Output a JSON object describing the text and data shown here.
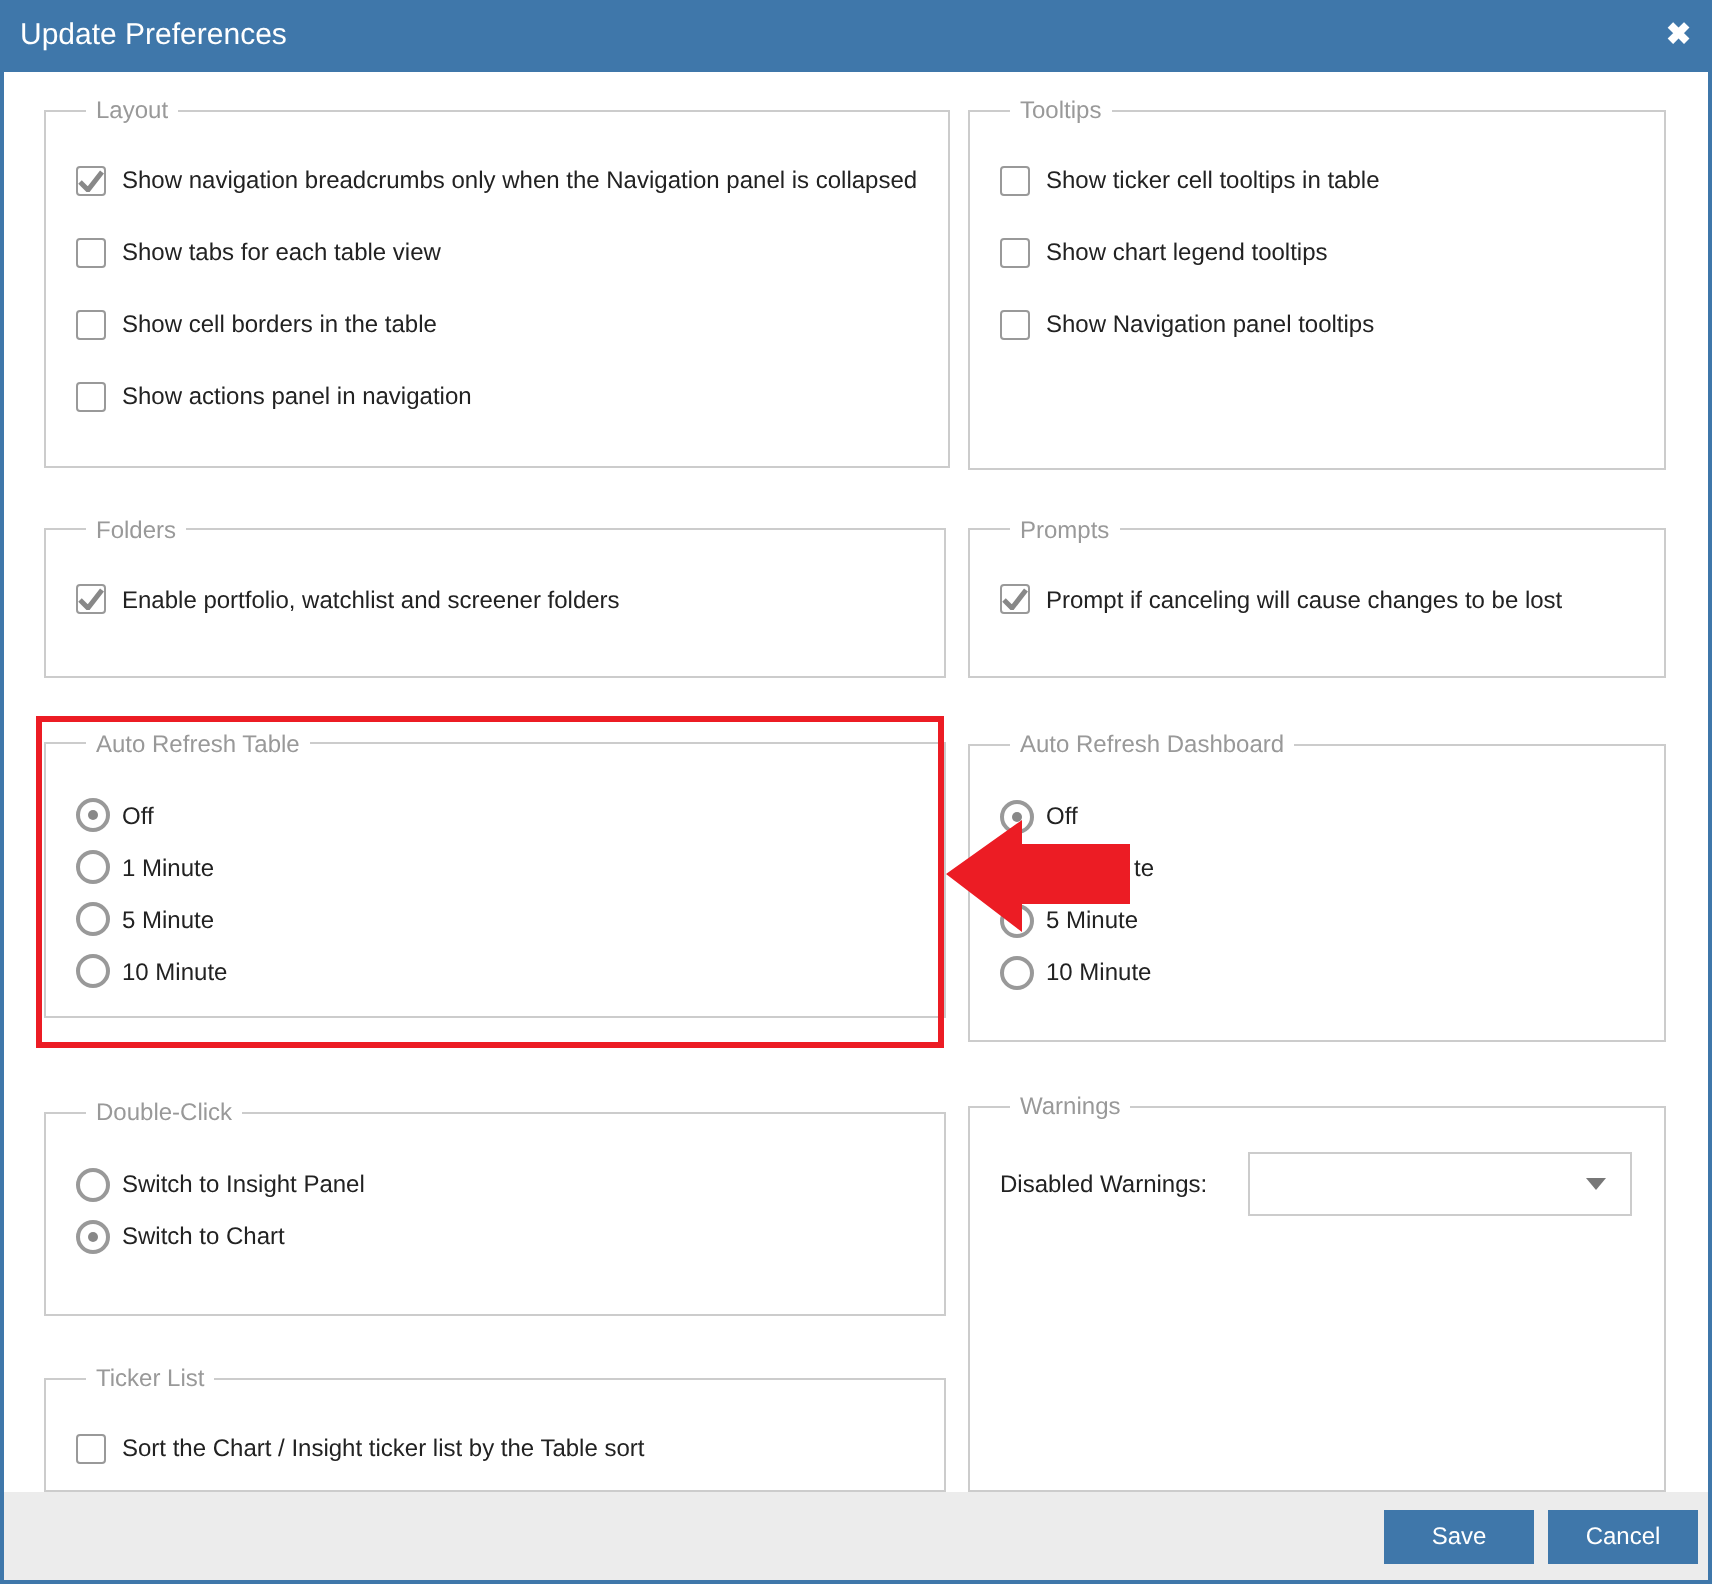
{
  "window": {
    "title": "Update Preferences",
    "close": "✖"
  },
  "left": [
    {
      "kind": "checks",
      "legend": "Layout",
      "items": [
        {
          "label": "Show navigation breadcrumbs only when the Navigation panel is collapsed",
          "checked": true
        },
        {
          "label": "Show tabs for each table view",
          "checked": false
        },
        {
          "label": "Show cell borders in the table",
          "checked": false
        },
        {
          "label": "Show actions panel in navigation",
          "checked": false
        }
      ]
    },
    {
      "kind": "checks",
      "legend": "Folders",
      "items": [
        {
          "label": "Enable portfolio, watchlist and screener folders",
          "checked": true
        }
      ]
    },
    {
      "kind": "radios",
      "legend": "Auto Refresh Table",
      "items": [
        {
          "label": "Off",
          "selected": true
        },
        {
          "label": "1 Minute",
          "selected": false
        },
        {
          "label": "5 Minute",
          "selected": false
        },
        {
          "label": "10 Minute",
          "selected": false
        }
      ]
    },
    {
      "kind": "radios",
      "legend": "Double-Click",
      "items": [
        {
          "label": "Switch to Insight Panel",
          "selected": false
        },
        {
          "label": "Switch to Chart",
          "selected": true
        }
      ]
    },
    {
      "kind": "checks",
      "legend": "Ticker List",
      "items": [
        {
          "label": "Sort the Chart / Insight ticker list by the Table sort",
          "checked": false
        }
      ]
    }
  ],
  "right": [
    {
      "kind": "checks",
      "legend": "Tooltips",
      "items": [
        {
          "label": "Show ticker cell tooltips in table",
          "checked": false
        },
        {
          "label": "Show chart legend tooltips",
          "checked": false
        },
        {
          "label": "Show Navigation panel tooltips",
          "checked": false
        }
      ]
    },
    {
      "kind": "checks",
      "legend": "Prompts",
      "items": [
        {
          "label": "Prompt if canceling will cause changes to be lost",
          "checked": true
        }
      ]
    },
    {
      "kind": "radios",
      "legend": "Auto Refresh Dashboard",
      "items": [
        {
          "label": "Off",
          "selected": true
        },
        {
          "label": "te",
          "kind": "covered"
        },
        {
          "label": "5 Minute",
          "kind": "partly_covered"
        },
        {
          "label": "10 Minute",
          "selected": false
        }
      ]
    },
    {
      "kind": "select",
      "legend": "Warnings",
      "label": "Disabled Warnings:"
    }
  ],
  "buttons": [
    "Save",
    "Cancel"
  ]
}
